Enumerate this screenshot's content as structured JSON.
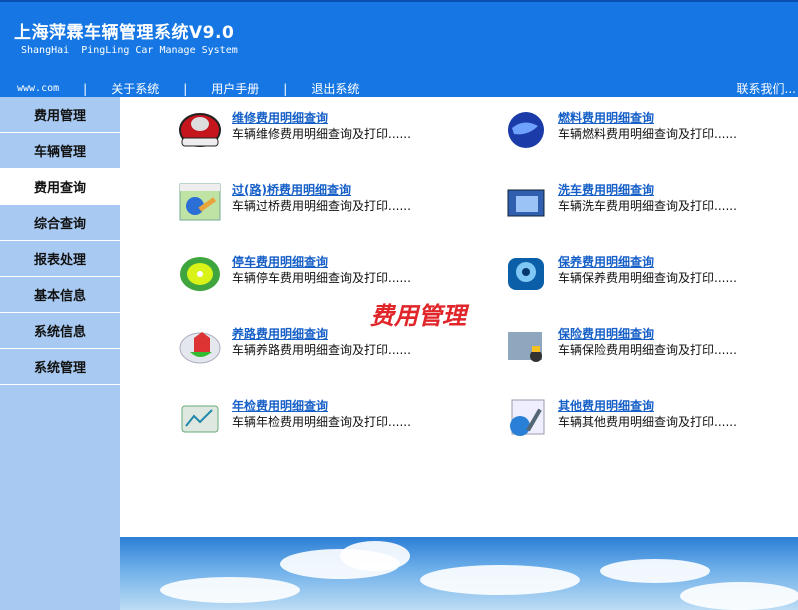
{
  "header": {
    "title": "上海萍霖车辆管理系统V9.0",
    "subtitle": "ShangHai  PingLing Car Manage System",
    "nav": [
      {
        "label": "www.com"
      },
      {
        "label": "关于系统"
      },
      {
        "label": "用户手册"
      },
      {
        "label": "退出系统"
      }
    ],
    "separator": "|",
    "contact": "联系我们..."
  },
  "sidebar": {
    "items": [
      {
        "label": "费用管理"
      },
      {
        "label": "车辆管理"
      },
      {
        "label": "费用查询",
        "active": true
      },
      {
        "label": "综合查询"
      },
      {
        "label": "报表处理"
      },
      {
        "label": "基本信息"
      },
      {
        "label": "系统信息"
      },
      {
        "label": "系统管理"
      }
    ]
  },
  "content": {
    "watermark": "费用管理",
    "items": [
      {
        "title": "维修费用明细查询",
        "desc": "车辆维修费用明细查询及打印......",
        "icon": "red-device-icon"
      },
      {
        "title": "燃料费用明细查询",
        "desc": "车辆燃料费用明细查询及打印......",
        "icon": "globe-icon"
      },
      {
        "title": "过(路)桥费用明细查询",
        "desc": "车辆过桥费用明细查询及打印......",
        "icon": "tools-window-icon"
      },
      {
        "title": "洗车费用明细查询",
        "desc": "车辆洗车费用明细查询及打印......",
        "icon": "folder-icon"
      },
      {
        "title": "停车费用明细查询",
        "desc": "车辆停车费用明细查询及打印......",
        "icon": "green-disc-icon"
      },
      {
        "title": "保养费用明细查询",
        "desc": "车辆保养费用明细查询及打印......",
        "icon": "speaker-icon"
      },
      {
        "title": "养路费用明细查询",
        "desc": "车辆养路费用明细查询及打印......",
        "icon": "house-badge-icon"
      },
      {
        "title": "保险费用明细查询",
        "desc": "车辆保险费用明细查询及打印......",
        "icon": "insurance-icon"
      },
      {
        "title": "年检费用明细查询",
        "desc": "车辆年检费用明细查询及打印......",
        "icon": "chart-tray-icon"
      },
      {
        "title": "其他费用明细查询",
        "desc": "车辆其他费用明细查询及打印......",
        "icon": "notepad-globe-icon"
      }
    ]
  }
}
